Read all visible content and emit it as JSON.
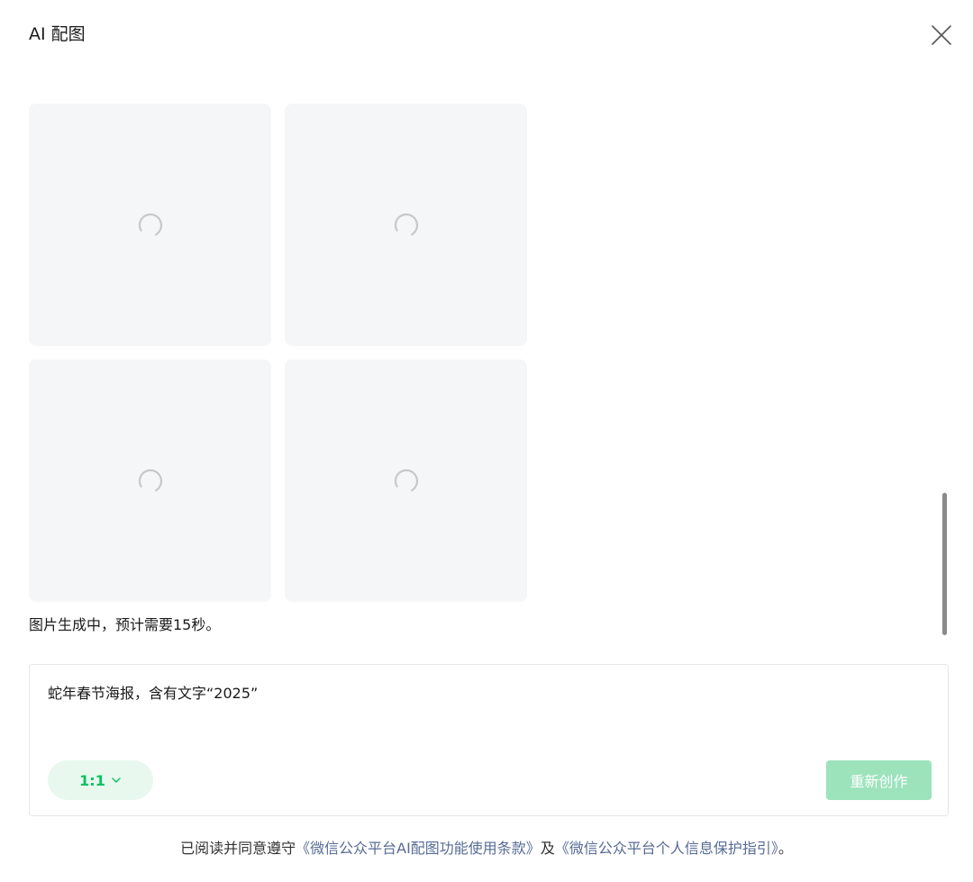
{
  "dialog": {
    "title": "AI 配图",
    "close_icon": "close-icon"
  },
  "images": {
    "tiles": [
      {
        "state": "loading",
        "icon": "loading-spinner-icon"
      },
      {
        "state": "loading",
        "icon": "loading-spinner-icon"
      },
      {
        "state": "loading",
        "icon": "loading-spinner-icon"
      },
      {
        "state": "loading",
        "icon": "loading-spinner-icon"
      }
    ],
    "status_text": "图片生成中，预计需要15秒。"
  },
  "prompt": {
    "text": "蛇年春节海报，含有文字“2025”",
    "ratio_label": "1:1",
    "ratio_icon": "chevron-down-icon",
    "regenerate_label": "重新创作"
  },
  "agreement": {
    "prefix": "已阅读并同意遵守",
    "terms_link": "《微信公众平台AI配图功能使用条款》",
    "conjunction": "及",
    "privacy_link": "《微信公众平台个人信息保护指引》",
    "suffix": "。"
  },
  "colors": {
    "accent": "#07c160",
    "accent_light_bg": "#e8f8ee",
    "button_disabled_bg": "#9ce3bc",
    "link": "#576b95",
    "tile_bg": "#f5f6f7"
  }
}
